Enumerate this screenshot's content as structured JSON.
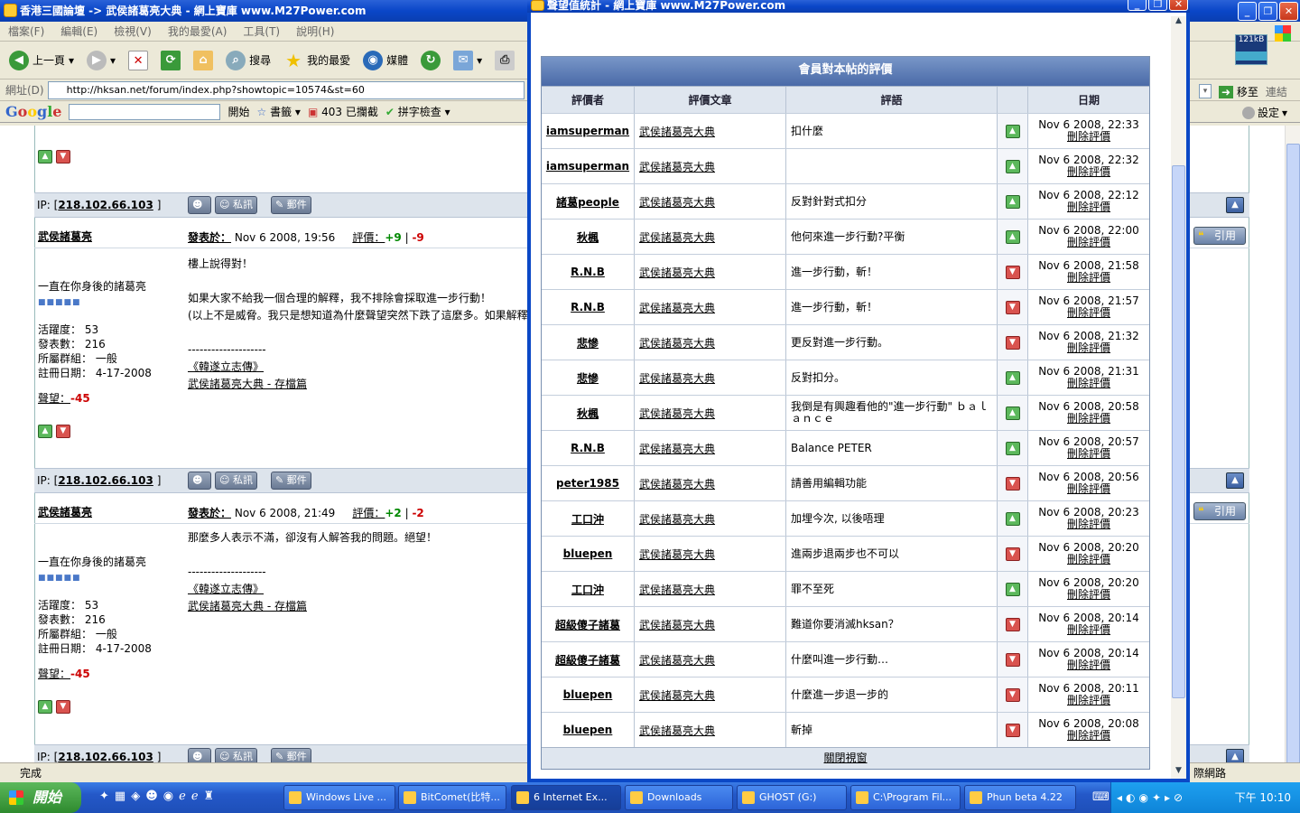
{
  "ie": {
    "title": "香港三國論壇 -> 武侯諸葛亮大典 - 網上寶庫 www.M27Power.com",
    "menu": [
      "檔案(F)",
      "編輯(E)",
      "檢視(V)",
      "我的最愛(A)",
      "工具(T)",
      "說明(H)"
    ],
    "toolbar": {
      "back": "上一頁",
      "search": "搜尋",
      "favorites": "我的最愛",
      "media": "媒體"
    },
    "address_label": "網址(D)",
    "address": "http://hksan.net/forum/index.php?showtopic=10574&st=60",
    "go_label": "移至",
    "links_label": "連結",
    "google": {
      "logo": "Google",
      "go": "開始",
      "bookmarks": "書籤",
      "blocked": "403 已攔截",
      "spell": "拼字檢查",
      "settings": "設定"
    },
    "net_speed": "121kB",
    "status": "完成",
    "zone": "際網路"
  },
  "forum": {
    "ip_label": "IP: [",
    "ip": "218.102.66.103",
    "ip_close": "]",
    "pm_label": "私訊",
    "mail_label": "郵件",
    "quote_label": "引用",
    "posts": [
      {
        "author": "武侯諸葛亮",
        "posted_label": "發表於：",
        "date": "Nov 6 2008, 19:56",
        "rating_label": "評價：",
        "rating_pos": "+9",
        "rating_neg": "-9",
        "body": [
          "樓上說得對！",
          "",
          "如果大家不給我一個合理的解釋，我不排除會採取進一步行動！",
          "(以上不是威脅。我只是想知道為什麼聲望突然下跌了這麼多。如果解釋"
        ],
        "sig_line": "--------------------",
        "sig1": "《韓遂立志傳》",
        "sig2": "武侯諸葛亮大典 - 存檔篇",
        "tagline": "一直在你身後的諸葛亮",
        "stats": [
          "活躍度： 53",
          "發表數： 216",
          "所屬群組： 一般",
          "註冊日期： 4-17-2008"
        ],
        "rep_label": "聲望：",
        "rep": "-45"
      },
      {
        "author": "武侯諸葛亮",
        "posted_label": "發表於：",
        "date": "Nov 6 2008, 21:49",
        "rating_label": "評價：",
        "rating_pos": "+2",
        "rating_neg": "-2",
        "body": [
          "那麼多人表示不滿，卻沒有人解答我的問題。絕望！"
        ],
        "sig_line": "--------------------",
        "sig1": "《韓遂立志傳》",
        "sig2": "武侯諸葛亮大典 - 存檔篇",
        "tagline": "一直在你身後的諸葛亮",
        "stats": [
          "活躍度： 53",
          "發表數： 216",
          "所屬群組： 一般",
          "註冊日期： 4-17-2008"
        ],
        "rep_label": "聲望：",
        "rep": "-45"
      }
    ]
  },
  "popup": {
    "title": "聲望值統計 - 網上寶庫 www.M27Power.com",
    "caption": "會員對本帖的評價",
    "headers": [
      "評價者",
      "評價文章",
      "評語",
      "",
      "日期"
    ],
    "delete_label": "刪除評價",
    "close_label": "關閉視窗",
    "rows": [
      {
        "user": "iamsuperman",
        "article": "武侯諸葛亮大典",
        "comment": "扣什麼",
        "vote": "up",
        "date": "Nov 6 2008, 22:33"
      },
      {
        "user": "iamsuperman",
        "article": "武侯諸葛亮大典",
        "comment": "",
        "vote": "up",
        "date": "Nov 6 2008, 22:32"
      },
      {
        "user": "諸葛people",
        "article": "武侯諸葛亮大典",
        "comment": "反對針對式扣分",
        "vote": "up",
        "date": "Nov 6 2008, 22:12"
      },
      {
        "user": "秋楓",
        "article": "武侯諸葛亮大典",
        "comment": "他何來進一步行動?平衡",
        "vote": "up",
        "date": "Nov 6 2008, 22:00"
      },
      {
        "user": "R.N.B",
        "article": "武侯諸葛亮大典",
        "comment": "進一步行動，斬！",
        "vote": "down",
        "date": "Nov 6 2008, 21:58"
      },
      {
        "user": "R.N.B",
        "article": "武侯諸葛亮大典",
        "comment": "進一步行動，斬！",
        "vote": "down",
        "date": "Nov 6 2008, 21:57"
      },
      {
        "user": "悲慘",
        "article": "武侯諸葛亮大典",
        "comment": "更反對進一步行動。",
        "vote": "down",
        "date": "Nov 6 2008, 21:32"
      },
      {
        "user": "悲慘",
        "article": "武侯諸葛亮大典",
        "comment": "反對扣分。",
        "vote": "up",
        "date": "Nov 6 2008, 21:31"
      },
      {
        "user": "秋楓",
        "article": "武侯諸葛亮大典",
        "comment": "我倒是有興趣看他的\"進一步行動\" ｂａｌａｎｃｅ",
        "vote": "up",
        "date": "Nov 6 2008, 20:58"
      },
      {
        "user": "R.N.B",
        "article": "武侯諸葛亮大典",
        "comment": "Balance PETER",
        "vote": "up",
        "date": "Nov 6 2008, 20:57"
      },
      {
        "user": "peter1985",
        "article": "武侯諸葛亮大典",
        "comment": "請善用編輯功能",
        "vote": "down",
        "date": "Nov 6 2008, 20:56"
      },
      {
        "user": "工口沖",
        "article": "武侯諸葛亮大典",
        "comment": "加埋今次, 以後唔理",
        "vote": "up",
        "date": "Nov 6 2008, 20:23"
      },
      {
        "user": "bluepen",
        "article": "武侯諸葛亮大典",
        "comment": "進兩步退兩步也不可以",
        "vote": "down",
        "date": "Nov 6 2008, 20:20"
      },
      {
        "user": "工口沖",
        "article": "武侯諸葛亮大典",
        "comment": "罪不至死",
        "vote": "up",
        "date": "Nov 6 2008, 20:20"
      },
      {
        "user": "超級傻子諸葛",
        "article": "武侯諸葛亮大典",
        "comment": "難道你要消滅hksan？",
        "vote": "down",
        "date": "Nov 6 2008, 20:14"
      },
      {
        "user": "超級傻子諸葛",
        "article": "武侯諸葛亮大典",
        "comment": "什麼叫進一步行動…",
        "vote": "down",
        "date": "Nov 6 2008, 20:14"
      },
      {
        "user": "bluepen",
        "article": "武侯諸葛亮大典",
        "comment": "什麼進一步退一步的",
        "vote": "down",
        "date": "Nov 6 2008, 20:11"
      },
      {
        "user": "bluepen",
        "article": "武侯諸葛亮大典",
        "comment": "斬掉",
        "vote": "down",
        "date": "Nov 6 2008, 20:08"
      }
    ]
  },
  "taskbar": {
    "start": "開始",
    "tasks": [
      "Windows Live ...",
      "BitComet(比特...",
      "6 Internet Ex...",
      "Downloads",
      "GHOST (G:)",
      "C:\\Program Fil...",
      "Phun beta 4.22"
    ],
    "clock": "下午 10:10"
  }
}
